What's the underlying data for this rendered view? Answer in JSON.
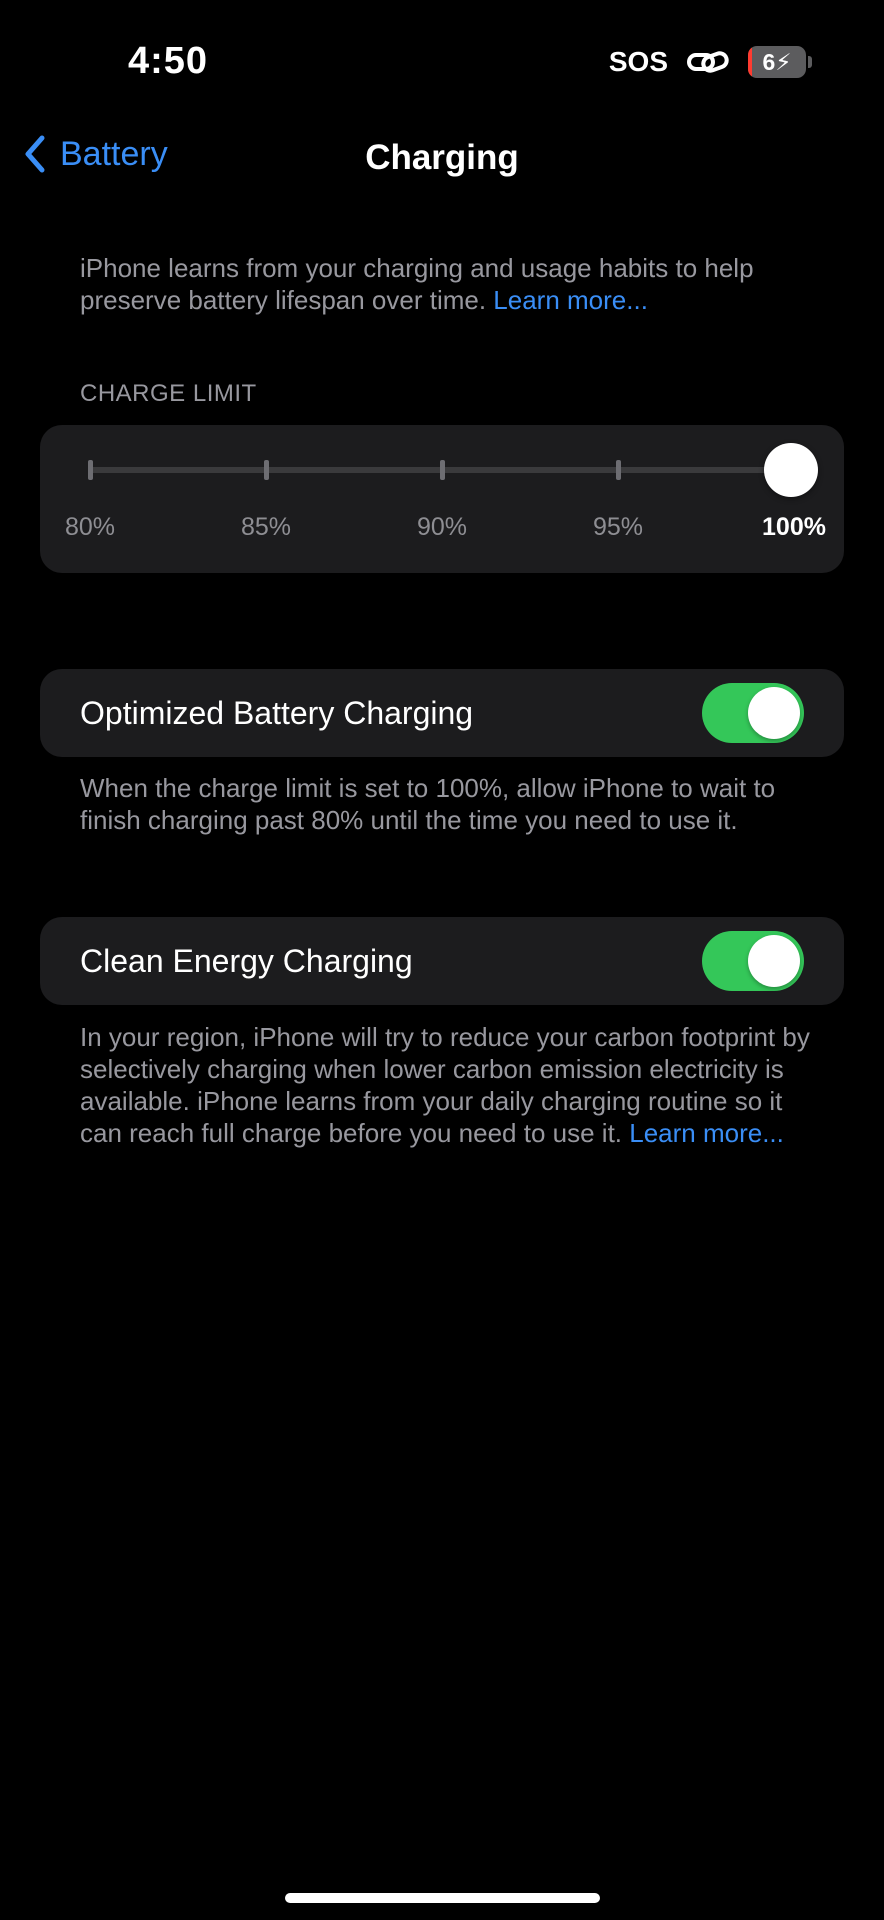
{
  "status_bar": {
    "time": "4:50",
    "sos": "SOS",
    "link_icon": "link-icon",
    "battery_level": "6",
    "battery_fraction": 0.06,
    "battery_charging_icon": "bolt-icon",
    "battery_fill_color": "#ff3b30"
  },
  "nav": {
    "back_label": "Battery",
    "back_icon": "chevron-left-icon",
    "title": "Charging"
  },
  "intro": {
    "text": "iPhone learns from your charging and usage habits to help preserve battery lifespan over time. ",
    "learn_more": "Learn more..."
  },
  "charge_limit": {
    "header": "CHARGE LIMIT",
    "options": [
      "80%",
      "85%",
      "90%",
      "95%",
      "100%"
    ],
    "selected_index": 4,
    "selected_value": "100%"
  },
  "optimized_charging": {
    "label": "Optimized Battery Charging",
    "enabled": true,
    "footer": "When the charge limit is set to 100%, allow iPhone to wait to finish charging past 80% until the time you need to use it."
  },
  "clean_energy": {
    "label": "Clean Energy Charging",
    "enabled": true,
    "footer": "In your region, iPhone will try to reduce your carbon footprint by selectively charging when lower carbon emission electricity is available. iPhone learns from your daily charging routine so it can reach full charge before you need to use it. ",
    "learn_more": "Learn more..."
  },
  "colors": {
    "accent": "#3a8ef6",
    "toggle_on": "#34c759",
    "card_bg": "#1c1c1e",
    "secondary_text": "#98989f"
  }
}
